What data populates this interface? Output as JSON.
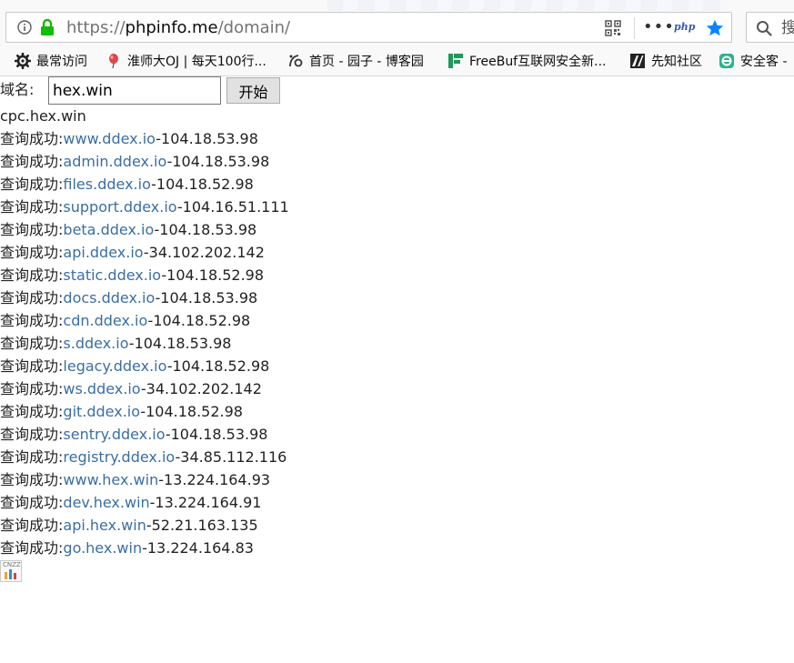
{
  "browser": {
    "url_protocol": "https://",
    "url_host": "phpinfo.me",
    "url_path": "/domain/",
    "php_badge": "php",
    "search_label": "搜",
    "bookmarks": [
      {
        "label": "最常访问",
        "icon": "gear-icon"
      },
      {
        "label": "淮师大OJ | 每天100行...",
        "icon": "balloon-icon"
      },
      {
        "label": "首页 - 园子 - 博客园",
        "icon": "cnblogs-icon"
      },
      {
        "label": "FreeBuf互联网安全新...",
        "icon": "freebuf-icon"
      },
      {
        "label": "先知社区",
        "icon": "xianzhi-icon"
      },
      {
        "label": "安全客 -",
        "icon": "anquanke-icon"
      }
    ]
  },
  "form": {
    "label": "域名:",
    "input_value": "hex.win",
    "button_label": "开始"
  },
  "queried_domain": "cpc.hex.win",
  "results": [
    {
      "prefix": "查询成功:",
      "domain": "www.ddex.io",
      "ip": "-104.18.53.98"
    },
    {
      "prefix": "查询成功:",
      "domain": "admin.ddex.io",
      "ip": "-104.18.53.98"
    },
    {
      "prefix": "查询成功:",
      "domain": "files.ddex.io",
      "ip": "-104.18.52.98"
    },
    {
      "prefix": "查询成功:",
      "domain": "support.ddex.io",
      "ip": "-104.16.51.111"
    },
    {
      "prefix": "查询成功:",
      "domain": "beta.ddex.io",
      "ip": "-104.18.53.98"
    },
    {
      "prefix": "查询成功:",
      "domain": "api.ddex.io",
      "ip": "-34.102.202.142"
    },
    {
      "prefix": "查询成功:",
      "domain": "static.ddex.io",
      "ip": "-104.18.52.98"
    },
    {
      "prefix": "查询成功:",
      "domain": "docs.ddex.io",
      "ip": "-104.18.53.98"
    },
    {
      "prefix": "查询成功:",
      "domain": "cdn.ddex.io",
      "ip": "-104.18.52.98"
    },
    {
      "prefix": "查询成功:",
      "domain": "s.ddex.io",
      "ip": "-104.18.53.98"
    },
    {
      "prefix": "查询成功:",
      "domain": "legacy.ddex.io",
      "ip": "-104.18.52.98"
    },
    {
      "prefix": "查询成功:",
      "domain": "ws.ddex.io",
      "ip": "-34.102.202.142"
    },
    {
      "prefix": "查询成功:",
      "domain": "git.ddex.io",
      "ip": "-104.18.52.98"
    },
    {
      "prefix": "查询成功:",
      "domain": "sentry.ddex.io",
      "ip": "-104.18.53.98"
    },
    {
      "prefix": "查询成功:",
      "domain": "registry.ddex.io",
      "ip": "-34.85.112.116"
    },
    {
      "prefix": "查询成功:",
      "domain": "www.hex.win",
      "ip": "-13.224.164.93"
    },
    {
      "prefix": "查询成功:",
      "domain": "dev.hex.win",
      "ip": "-13.224.164.91"
    },
    {
      "prefix": "查询成功:",
      "domain": "api.hex.win",
      "ip": "-52.21.163.135"
    },
    {
      "prefix": "查询成功:",
      "domain": "go.hex.win",
      "ip": "-13.224.164.83"
    }
  ],
  "badge": {
    "label": "CNZZ",
    "icon": "cnzz-stats-icon"
  },
  "colors": {
    "link": "#3a6ea5",
    "lock": "#12bc00",
    "star": "#0a84ff"
  }
}
